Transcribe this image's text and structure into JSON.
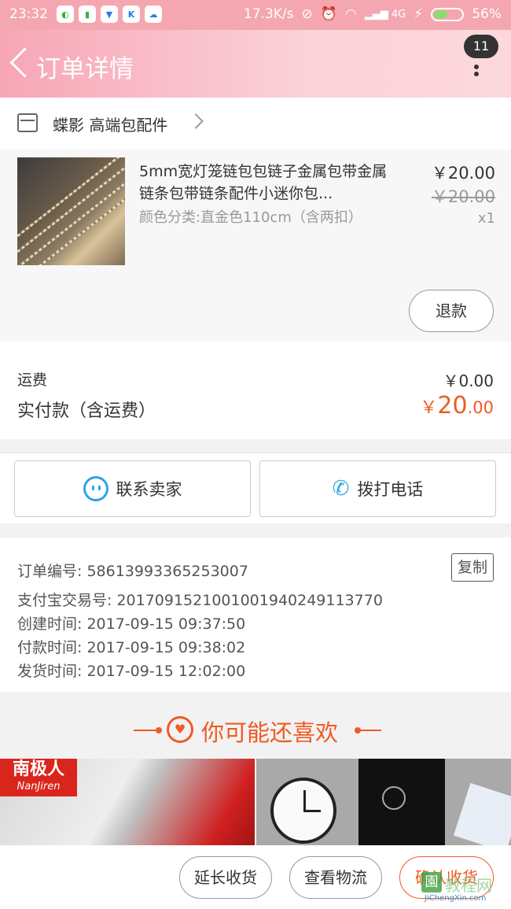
{
  "status_bar": {
    "time": "23:32",
    "network_speed": "17.3K/s",
    "signal": "4G",
    "battery": "56%",
    "battery_level": 0.56,
    "icons": [
      "wechat-icon",
      "sim-icon",
      "shield-icon",
      "k-icon",
      "cloud-icon",
      "alarm-off-icon",
      "alarm-icon",
      "wifi-icon",
      "signal-icon",
      "charging-icon",
      "battery-icon"
    ]
  },
  "header": {
    "title": "订单详情",
    "badge_count": "11",
    "colors": {
      "gradient_start": "#f7a6b6",
      "gradient_end": "#fcd8dd"
    }
  },
  "store": {
    "name": "蝶影 高端包配件"
  },
  "item": {
    "title": "5mm宽灯笼链包包链子金属包带金属链条包带链条配件小迷你包...",
    "sku": "颜色分类:直金色110cm（含两扣）",
    "price": "￥20.00",
    "original_price": "￥20.00",
    "quantity": "x1",
    "refund_label": "退款"
  },
  "summary": {
    "shipping_label": "运费",
    "shipping_value": "￥0.00",
    "paid_label": "实付款（含运费）",
    "paid_currency": "￥",
    "paid_integer": "20",
    "paid_decimal": ".00",
    "accent_color": "#f05a23"
  },
  "contact": {
    "seller_label": "联系卖家",
    "call_label": "拨打电话"
  },
  "order_info": {
    "order_no": "订单编号: 58613993365253007",
    "copy_label": "复制",
    "alipay_no": "支付宝交易号: 2017091521001001940249113770",
    "created": "创建时间: 2017-09-15 09:37:50",
    "paid": "付款时间: 2017-09-15 09:38:02",
    "shipped": "发货时间: 2017-09-15 12:02:00"
  },
  "recommend": {
    "title": "你可能还喜欢",
    "brand_cn": "南极人",
    "brand_en": "NanJiren"
  },
  "bottom_bar": {
    "extend_label": "延长收货",
    "logistics_label": "查看物流",
    "confirm_label": "确认收货"
  },
  "watermark": {
    "box_char": "園",
    "text": "教程网",
    "url": "JiChengXin.com"
  }
}
